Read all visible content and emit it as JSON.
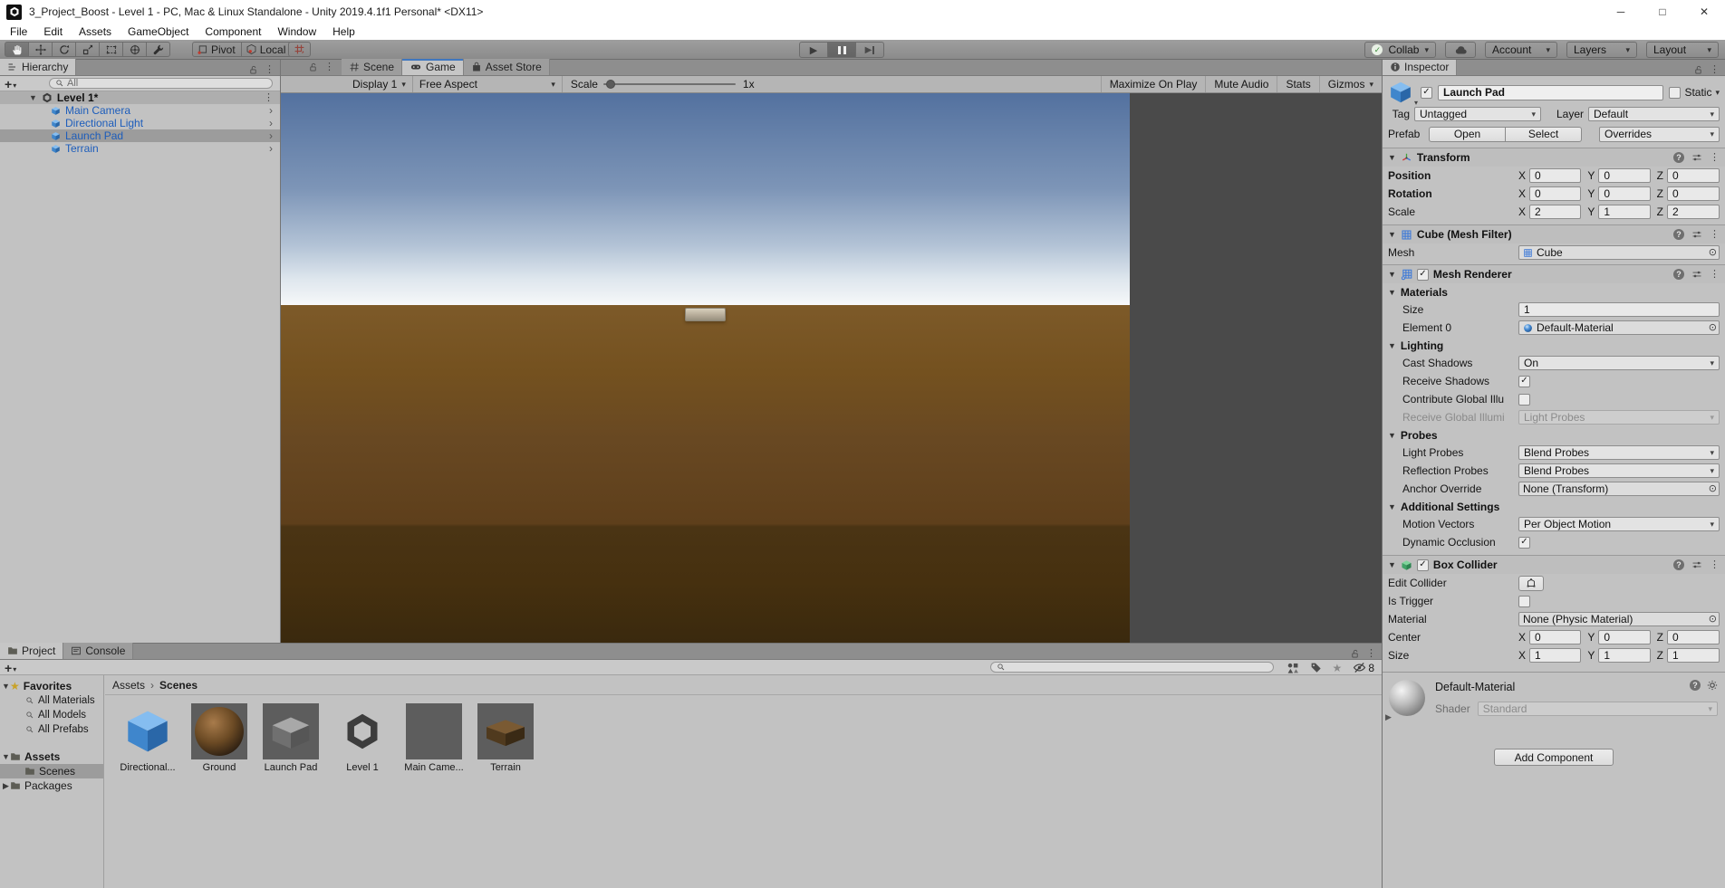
{
  "glyphs": {
    "dropdown": "▾",
    "foldout_open": "▼",
    "foldout_closed": "▶",
    "kebab": "⋮",
    "chevron": "›",
    "plus": "+",
    "check": "✓",
    "picker": "⊙",
    "minimize": "─",
    "maximize": "□",
    "close": "✕",
    "breadcrumb_sep": "›",
    "play": "▶",
    "step_play": "▶"
  },
  "colors": {
    "game_tab_accent": "#4077bf",
    "prefab_text_blue": "#1d5dbb",
    "selection_gray": "#9c9c9c",
    "collab_check_green": "#3f8f3f"
  },
  "window": {
    "title": "3_Project_Boost - Level 1 - PC, Mac & Linux Standalone - Unity 2019.4.1f1 Personal* <DX11>"
  },
  "menu": {
    "items": [
      "File",
      "Edit",
      "Assets",
      "GameObject",
      "Component",
      "Window",
      "Help"
    ]
  },
  "toolbar": {
    "pivot": "Pivot",
    "local": "Local",
    "collab": "Collab",
    "account": "Account",
    "layers": "Layers",
    "layout": "Layout"
  },
  "hierarchy": {
    "tab": "Hierarchy",
    "search_placeholder": "All",
    "scene_name": "Level 1*",
    "items": [
      {
        "label": "Main Camera"
      },
      {
        "label": "Directional Light"
      },
      {
        "label": "Launch Pad"
      },
      {
        "label": "Terrain"
      }
    ]
  },
  "game": {
    "tab_scene": "Scene",
    "tab_game": "Game",
    "tab_asset_store": "Asset Store",
    "display": "Display 1",
    "aspect": "Free Aspect",
    "scale_label": "Scale",
    "scale_value": "1x",
    "maximize_on_play": "Maximize On Play",
    "mute_audio": "Mute Audio",
    "stats": "Stats",
    "gizmos": "Gizmos"
  },
  "inspector": {
    "tab": "Inspector",
    "name": "Launch Pad",
    "static_label": "Static",
    "tag_label": "Tag",
    "tag_value": "Untagged",
    "layer_label": "Layer",
    "layer_value": "Default",
    "prefab_label": "Prefab",
    "open": "Open",
    "select": "Select",
    "overrides": "Overrides",
    "axes": {
      "x": "X",
      "y": "Y",
      "z": "Z"
    },
    "transform": {
      "title": "Transform",
      "position_label": "Position",
      "rotation_label": "Rotation",
      "scale_label": "Scale",
      "position": {
        "x": "0",
        "y": "0",
        "z": "0"
      },
      "rotation": {
        "x": "0",
        "y": "0",
        "z": "0"
      },
      "scale": {
        "x": "2",
        "y": "1",
        "z": "2"
      }
    },
    "mesh_filter": {
      "title": "Cube (Mesh Filter)",
      "mesh_label": "Mesh",
      "mesh_value": "Cube"
    },
    "mesh_renderer": {
      "title": "Mesh Renderer",
      "materials_label": "Materials",
      "size_label": "Size",
      "size_value": "1",
      "element0_label": "Element 0",
      "element0_value": "Default-Material",
      "lighting_label": "Lighting",
      "cast_shadows_label": "Cast Shadows",
      "cast_shadows_value": "On",
      "receive_shadows_label": "Receive Shadows",
      "contribute_gi_label": "Contribute Global Illu",
      "receive_gi_label": "Receive Global Illumi",
      "receive_gi_value": "Light Probes",
      "probes_label": "Probes",
      "light_probes_label": "Light Probes",
      "light_probes_value": "Blend Probes",
      "reflection_probes_label": "Reflection Probes",
      "reflection_probes_value": "Blend Probes",
      "anchor_label": "Anchor Override",
      "anchor_value": "None (Transform)",
      "additional_label": "Additional Settings",
      "motion_vectors_label": "Motion Vectors",
      "motion_vectors_value": "Per Object Motion",
      "dynamic_occlusion_label": "Dynamic Occlusion"
    },
    "box_collider": {
      "title": "Box Collider",
      "edit_collider_label": "Edit Collider",
      "is_trigger_label": "Is Trigger",
      "material_label": "Material",
      "material_value": "None (Physic Material)",
      "center_label": "Center",
      "center": {
        "x": "0",
        "y": "0",
        "z": "0"
      },
      "size_label": "Size",
      "size": {
        "x": "1",
        "y": "1",
        "z": "1"
      }
    },
    "material": {
      "title": "Default-Material",
      "shader_label": "Shader",
      "shader_value": "Standard"
    },
    "add_component": "Add Component"
  },
  "project": {
    "tab_project": "Project",
    "tab_console": "Console",
    "favorites_label": "Favorites",
    "favorites": [
      {
        "label": "All Materials"
      },
      {
        "label": "All Models"
      },
      {
        "label": "All Prefabs"
      }
    ],
    "folder_assets": "Assets",
    "folder_scenes": "Scenes",
    "folder_packages": "Packages",
    "breadcrumb_root": "Assets",
    "breadcrumb_current": "Scenes",
    "hidden_count": "8",
    "assets": [
      {
        "label": "Directional..."
      },
      {
        "label": "Ground"
      },
      {
        "label": "Launch Pad"
      },
      {
        "label": "Level 1"
      },
      {
        "label": "Main Came..."
      },
      {
        "label": "Terrain"
      }
    ]
  }
}
